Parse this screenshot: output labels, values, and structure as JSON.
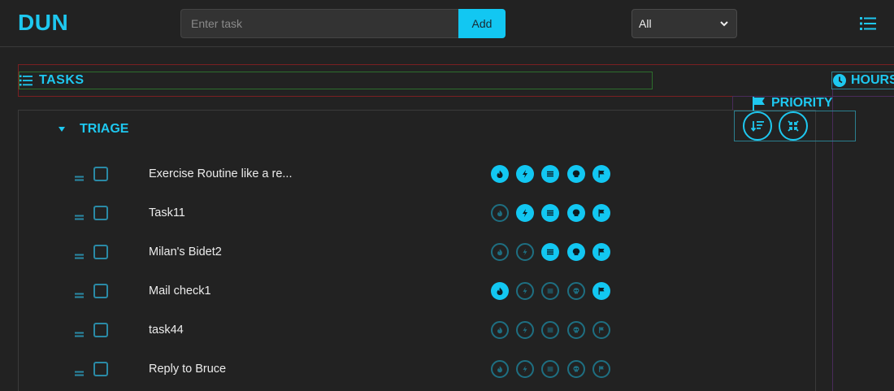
{
  "header": {
    "brand": "DUN",
    "task_input_placeholder": "Enter task",
    "add_label": "Add",
    "filter_value": "All",
    "menu_icon": "list-icon"
  },
  "sections": {
    "tasks_label": "TASKS",
    "hours_label": "HOURS",
    "priority_label": "PRIORITY",
    "group_label": "TRIAGE"
  },
  "tag_icons": [
    "fire-icon",
    "bolt-icon",
    "layers-icon",
    "skull-icon",
    "flag-icon"
  ],
  "tasks": [
    {
      "title": "Exercise Routine like a re...",
      "tags": [
        true,
        true,
        true,
        true,
        true
      ]
    },
    {
      "title": "Task11",
      "tags": [
        false,
        true,
        true,
        true,
        true
      ]
    },
    {
      "title": "Milan's Bidet2",
      "tags": [
        false,
        false,
        true,
        true,
        true
      ]
    },
    {
      "title": "Mail check1",
      "tags": [
        true,
        false,
        false,
        false,
        true
      ]
    },
    {
      "title": "task44",
      "tags": [
        false,
        false,
        false,
        false,
        false
      ]
    },
    {
      "title": "Reply to Bruce",
      "tags": [
        false,
        false,
        false,
        false,
        false
      ]
    }
  ],
  "colors": {
    "accent": "#12c7f2",
    "background": "#222222",
    "muted_icon": "#1e6f82"
  }
}
